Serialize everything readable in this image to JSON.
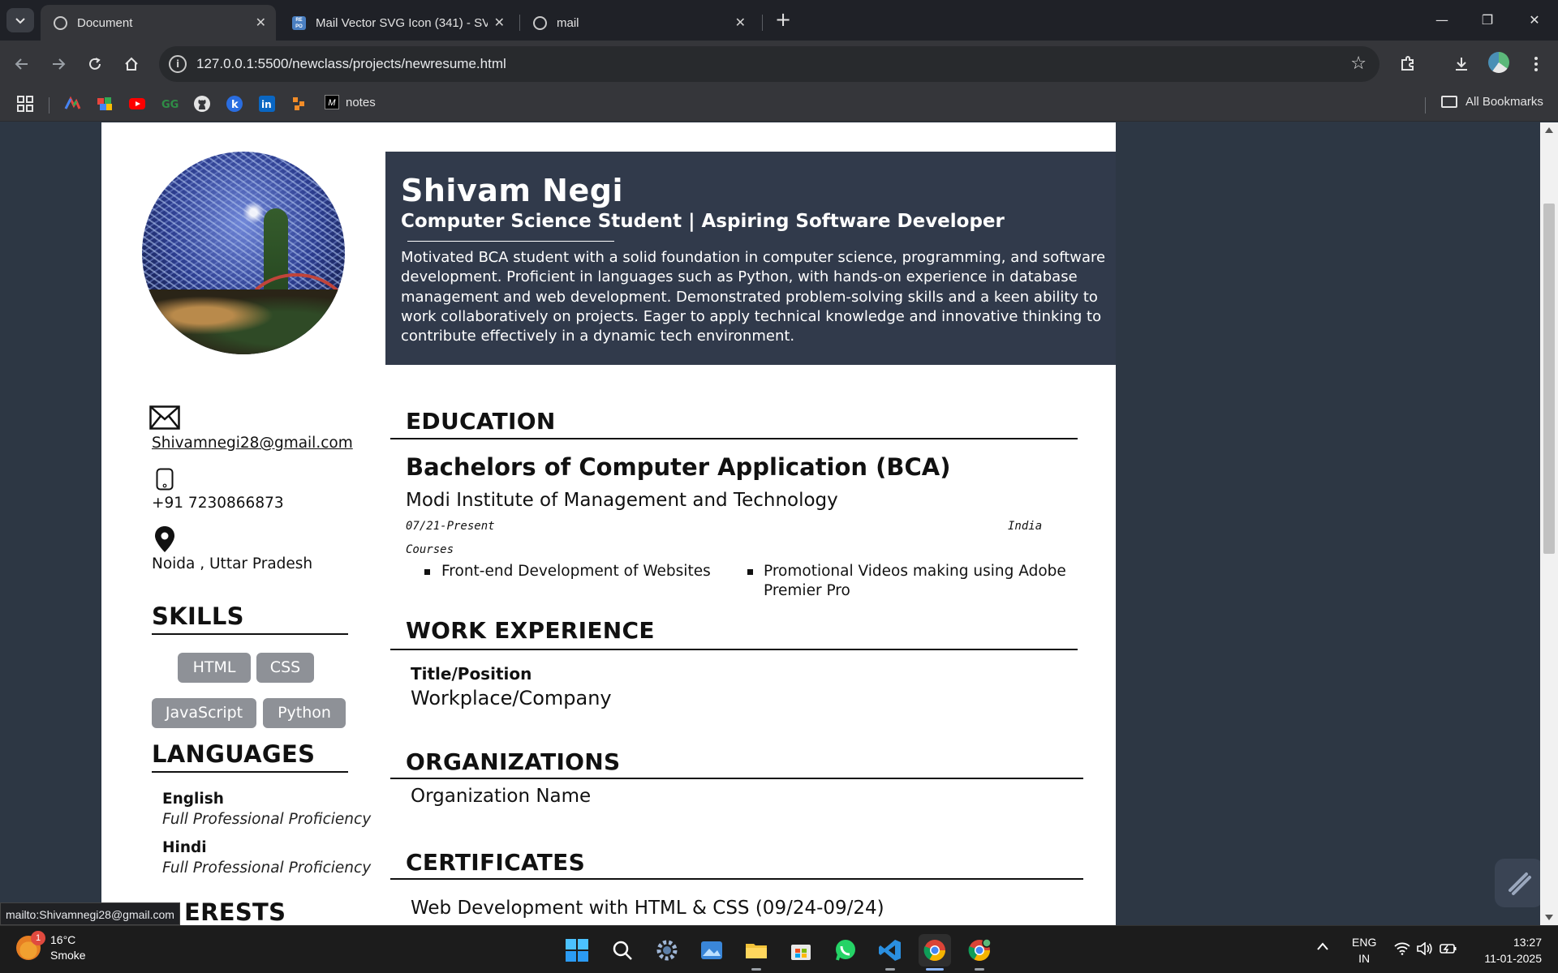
{
  "browser": {
    "tabs": [
      {
        "title": "Document",
        "active": true
      },
      {
        "title": "Mail Vector SVG Icon (341) - SV",
        "active": false
      },
      {
        "title": "mail",
        "active": false
      }
    ],
    "url": "127.0.0.1:5500/newclass/projects/newresume.html",
    "bookmarks": {
      "notes_label": "notes",
      "all_bookmarks_label": "All Bookmarks"
    },
    "status_tooltip": "mailto:Shivamnegi28@gmail.com"
  },
  "resume": {
    "name": "Shivam Negi",
    "role": "Computer Science Student | Aspiring Software Developer",
    "summary": "Motivated BCA student with a solid foundation in computer science, programming, and software development. Proficient in languages such as Python, with hands-on experience in database management and web development. Demonstrated problem-solving skills and a keen ability to work collaboratively on projects. Eager to apply technical knowledge and innovative thinking to contribute effectively in a dynamic tech environment.",
    "contact": {
      "email": "Shivamnegi28@gmail.com",
      "phone": "+91 7230866873",
      "location": "Noida , Uttar Pradesh"
    },
    "skills_heading": "SKILLS",
    "skills": [
      "HTML",
      "CSS",
      "JavaScript",
      "Python"
    ],
    "languages_heading": "LANGUAGES",
    "languages": [
      {
        "name": "English",
        "level": "Full Professional Proficiency"
      },
      {
        "name": "Hindi",
        "level": "Full Professional Proficiency"
      }
    ],
    "interests_heading_partial": "ERESTS",
    "education_heading": "EDUCATION",
    "education": {
      "degree": "Bachelors of Computer Application (BCA)",
      "school": "Modi Institute of Management and Technology",
      "dates": "07/21-Present",
      "location": "India",
      "courses_label": "Courses",
      "courses": [
        "Front-end Development of Websites",
        "Promotional Videos making using Adobe Premier Pro"
      ]
    },
    "work_heading": "WORK EXPERIENCE",
    "work": {
      "title": "Title/Position",
      "place": "Workplace/Company"
    },
    "organizations_heading": "ORGANIZATIONS",
    "organization": "Organization Name",
    "certificates_heading": "CERTIFICATES",
    "certificate": "Web Development with HTML & CSS (09/24-09/24)"
  },
  "taskbar": {
    "weather_temp": "16°C",
    "weather_desc": "Smoke",
    "weather_badge": "1",
    "lang_line1": "ENG",
    "lang_line2": "IN",
    "time": "13:27",
    "date": "11-01-2025"
  },
  "colors": {
    "header_band": "#313a4b",
    "page_bg": "#2d3744",
    "skill_chip": "#8e9197"
  }
}
